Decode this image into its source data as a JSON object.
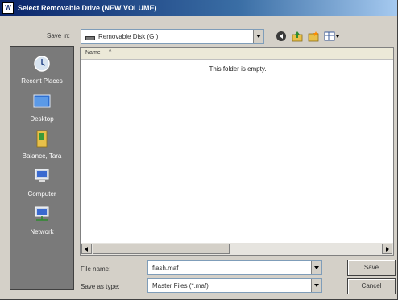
{
  "window": {
    "title": "Select Removable Drive (NEW VOLUME)",
    "app_icon_text": "W"
  },
  "toolbar": {
    "save_in_label": "Save in:",
    "save_in_value": "Removable Disk (G:)",
    "icons": [
      "back-icon",
      "up-folder-icon",
      "new-folder-icon",
      "views-menu-icon"
    ]
  },
  "places": [
    {
      "label": "Recent Places",
      "icon": "recent-places-icon"
    },
    {
      "label": "Desktop",
      "icon": "desktop-icon"
    },
    {
      "label": "Balance, Tara",
      "icon": "user-folder-icon"
    },
    {
      "label": "Computer",
      "icon": "computer-icon"
    },
    {
      "label": "Network",
      "icon": "network-icon"
    }
  ],
  "file_list": {
    "column_name": "Name",
    "empty_message": "This folder is empty."
  },
  "form": {
    "file_name_label": "File name:",
    "file_name_value": "flash.maf",
    "save_as_type_label": "Save as type:",
    "save_as_type_value": "Master Files (*.maf)"
  },
  "buttons": {
    "save": "Save",
    "cancel": "Cancel"
  },
  "colors": {
    "title_bar_start": "#0a246a",
    "dialog_face": "#d4d0c8",
    "places_bar": "#7a7a7a"
  }
}
